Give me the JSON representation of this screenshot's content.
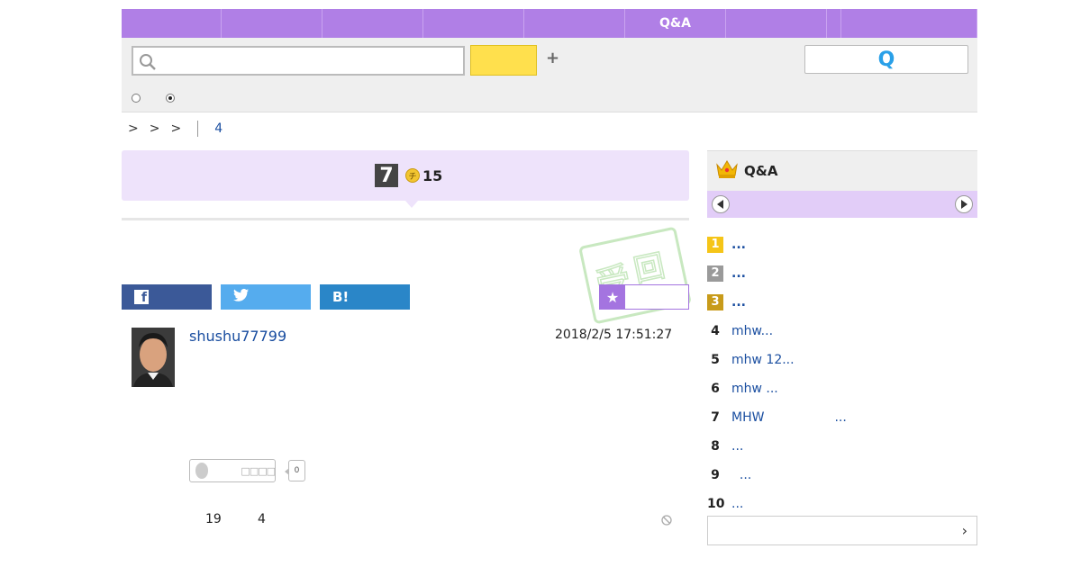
{
  "nav": {
    "tabs": [
      {
        "label": "",
        "width": 111
      },
      {
        "label": "",
        "width": 112
      },
      {
        "label": "",
        "width": 112
      },
      {
        "label": "",
        "width": 112
      },
      {
        "label": "",
        "width": 112
      },
      {
        "label": "Q&A",
        "width": 112
      },
      {
        "label": "",
        "width": 112
      },
      {
        "label": "",
        "width": 16
      },
      {
        "label": "",
        "width": 151
      }
    ]
  },
  "search": {
    "value": "",
    "placeholder": "",
    "submit_label": "",
    "add_symbol": "+",
    "q_button_label": "Q"
  },
  "breadcrumb": {
    "sep1": ">",
    "sep2": ">",
    "sep3": ">",
    "page_number": "4"
  },
  "question": {
    "badge_number": "7",
    "coin_icon_char": "チ",
    "coin_count": "15"
  },
  "share": {
    "facebook_label": "",
    "twitter_label": "",
    "hatena_label": "B!",
    "favorite_label": ""
  },
  "answer": {
    "username": "shushu77799",
    "timestamp": "2018/2/5  17:51:27",
    "like_label": "□□□□",
    "like_count": "0",
    "stat_a": "19",
    "stat_b": "4"
  },
  "ranking": {
    "title": "Q&A",
    "items": [
      {
        "rank": "1",
        "title": "...",
        "medal": "#f5c518"
      },
      {
        "rank": "2",
        "title": "...",
        "medal": "#9a9a9a"
      },
      {
        "rank": "3",
        "title": "...",
        "medal": "#c89b1a"
      },
      {
        "rank": "4",
        "title": "mhw..."
      },
      {
        "rank": "5",
        "title": "mhw 12..."
      },
      {
        "rank": "6",
        "title": "mhw ..."
      },
      {
        "rank": "7",
        "title": "MHW",
        "title2": "..."
      },
      {
        "rank": "8",
        "title": "..."
      },
      {
        "rank": "9",
        "title": "  ..."
      },
      {
        "rank": "10",
        "title": "..."
      }
    ],
    "more_label": ""
  },
  "colors": {
    "nav_purple": "#b07fe6",
    "search_yellow": "#ffe04d",
    "link_blue": "#1a4ea0",
    "facebook": "#3b5998",
    "twitter": "#55acee",
    "hatena": "#2a86c8"
  }
}
